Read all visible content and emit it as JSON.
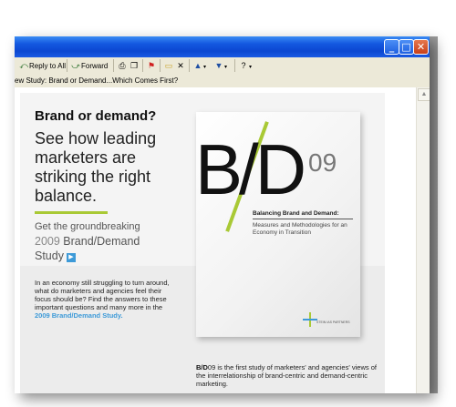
{
  "window": {
    "controls": [
      "minimize",
      "maximize",
      "close"
    ]
  },
  "toolbar": {
    "reply_all_label": "Reply to All",
    "forward_label": "Forward",
    "print_icon": "printer-icon",
    "copy_icon": "copy-icon",
    "flag_icon": "flag-icon",
    "move_icon": "move-to-folder-icon",
    "delete_icon": "delete-x-icon",
    "prev_icon": "up-arrow-icon",
    "next_icon": "down-arrow-icon",
    "help_icon": "help-icon"
  },
  "subject": "ew Study: Brand or Demand...Which Comes First?",
  "email": {
    "headline": "Brand or demand?",
    "subhead": "See how leading marketers are striking the right balance.",
    "cta_line1": "Get the groundbreaking",
    "cta_year": "2009",
    "cta_brand_demand": "Brand/Demand",
    "cta_study": "Study",
    "body_text": "In an economy still struggling to turn around, what do marketers and agencies feel their focus should be? Find the answers to these important questions and many more in the",
    "body_link": "2009 Brand/Demand Study.",
    "book": {
      "big_bd": "B/D",
      "edition": "09",
      "title": "Balancing Brand and Demand:",
      "subtitle": "Measures and Methodologies for an Economy in Transition",
      "publisher": "STEIN IAS  PARTNERS"
    },
    "footnote_bold": "B/D",
    "footnote_edition": "09",
    "footnote_text": " is the first study of marketers' and agencies' views of the interrelationship of brand-centric and demand-centric marketing."
  },
  "colors": {
    "accent_green": "#a9c935",
    "link_blue": "#3d9ad8",
    "title_blue": "#0b47d1"
  }
}
